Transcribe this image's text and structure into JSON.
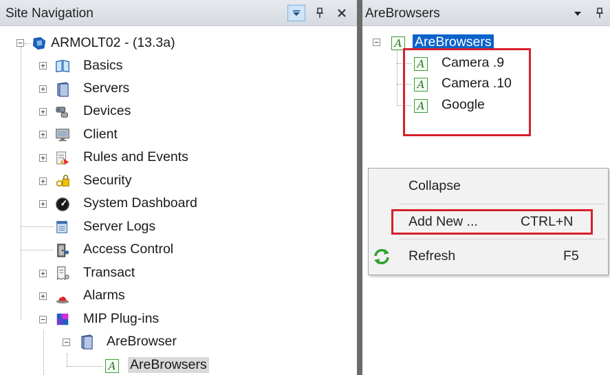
{
  "left_pane": {
    "title": "Site Navigation",
    "tree": {
      "root": {
        "label": "ARMOLT02 - (13.3a)"
      },
      "items": [
        {
          "label": "Basics",
          "icon": "book-icon"
        },
        {
          "label": "Servers",
          "icon": "server-icon"
        },
        {
          "label": "Devices",
          "icon": "camera-icon"
        },
        {
          "label": "Client",
          "icon": "monitor-icon"
        },
        {
          "label": "Rules and Events",
          "icon": "rules-icon"
        },
        {
          "label": "Security",
          "icon": "lock-key-icon"
        },
        {
          "label": "System Dashboard",
          "icon": "dashboard-icon"
        },
        {
          "label": "Server Logs",
          "icon": "logs-icon"
        },
        {
          "label": "Access Control",
          "icon": "door-icon"
        },
        {
          "label": "Transact",
          "icon": "receipt-icon"
        },
        {
          "label": "Alarms",
          "icon": "alarm-icon"
        },
        {
          "label": "MIP Plug-ins",
          "icon": "puzzle-icon"
        }
      ],
      "plugin": {
        "label": "AreBrowser"
      },
      "plugin_child": {
        "label": "AreBrowsers"
      }
    }
  },
  "right_pane": {
    "title": "AreBrowsers",
    "tree": {
      "root": {
        "label": "AreBrowsers"
      },
      "children": [
        "Camera .9",
        "Camera .10",
        "Google"
      ]
    }
  },
  "context_menu": {
    "collapse": {
      "label": "Collapse"
    },
    "add_new": {
      "label": "Add New ...",
      "shortcut": "CTRL+N"
    },
    "refresh": {
      "label": "Refresh",
      "shortcut": "F5"
    }
  },
  "colors": {
    "highlight_red": "#d6202b",
    "selection_blue": "#0a63c9",
    "item_icon_green": "#3a9a3a"
  }
}
